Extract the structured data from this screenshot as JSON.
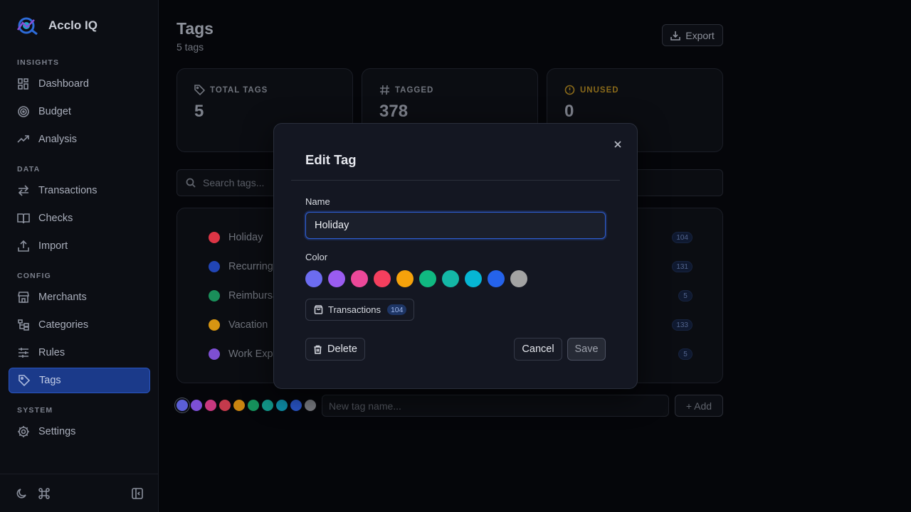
{
  "app": {
    "name": "Acclo IQ"
  },
  "sidebar": {
    "sections": [
      {
        "label": "INSIGHTS",
        "items": [
          {
            "label": "Dashboard",
            "icon": "dashboard-icon"
          },
          {
            "label": "Budget",
            "icon": "target-icon"
          },
          {
            "label": "Analysis",
            "icon": "trend-icon"
          }
        ]
      },
      {
        "label": "DATA",
        "items": [
          {
            "label": "Transactions",
            "icon": "arrows-icon"
          },
          {
            "label": "Checks",
            "icon": "book-icon"
          },
          {
            "label": "Import",
            "icon": "upload-icon"
          }
        ]
      },
      {
        "label": "CONFIG",
        "items": [
          {
            "label": "Merchants",
            "icon": "store-icon"
          },
          {
            "label": "Categories",
            "icon": "tree-icon"
          },
          {
            "label": "Rules",
            "icon": "sliders-icon"
          },
          {
            "label": "Tags",
            "icon": "tag-icon",
            "active": true
          }
        ]
      },
      {
        "label": "SYSTEM",
        "items": [
          {
            "label": "Settings",
            "icon": "gear-icon"
          }
        ]
      }
    ]
  },
  "page": {
    "title": "Tags",
    "subtitle": "5 tags",
    "export_label": "Export"
  },
  "stats": {
    "total": {
      "label": "TOTAL TAGS",
      "value": "5"
    },
    "tagged": {
      "label": "TAGGED",
      "value": "378"
    },
    "unused": {
      "label": "UNUSED",
      "value": "0"
    }
  },
  "search": {
    "placeholder": "Search tags..."
  },
  "tags": [
    {
      "name": "Holiday",
      "color": "#dc3545",
      "count": "104"
    },
    {
      "name": "Recurring",
      "color": "#2145b5",
      "count": "131"
    },
    {
      "name": "Reimbursa",
      "color": "#1a8f5a",
      "count": "5"
    },
    {
      "name": "Vacation",
      "color": "#d69512",
      "count": "133"
    },
    {
      "name": "Work Expe",
      "color": "#7d4fd3",
      "count": "5"
    }
  ],
  "new_tag": {
    "placeholder": "New tag name...",
    "add_label": "+ Add",
    "colors": [
      "#5b5fd6",
      "#7c4fd6",
      "#c8387f",
      "#c43a4c",
      "#c98410",
      "#16925c",
      "#12968a",
      "#0e8ea8",
      "#2a56c9",
      "#7a7c82"
    ]
  },
  "modal": {
    "title": "Edit Tag",
    "name_label": "Name",
    "name_value": "Holiday",
    "color_label": "Color",
    "colors": [
      "#6c6cf0",
      "#9a5cf0",
      "#ec4899",
      "#f43f5e",
      "#f5a20b",
      "#10b981",
      "#14b8a6",
      "#06b6d4",
      "#2563eb",
      "#a3a3a3"
    ],
    "transactions_label": "Transactions",
    "transactions_count": "104",
    "delete_label": "Delete",
    "cancel_label": "Cancel",
    "save_label": "Save"
  }
}
